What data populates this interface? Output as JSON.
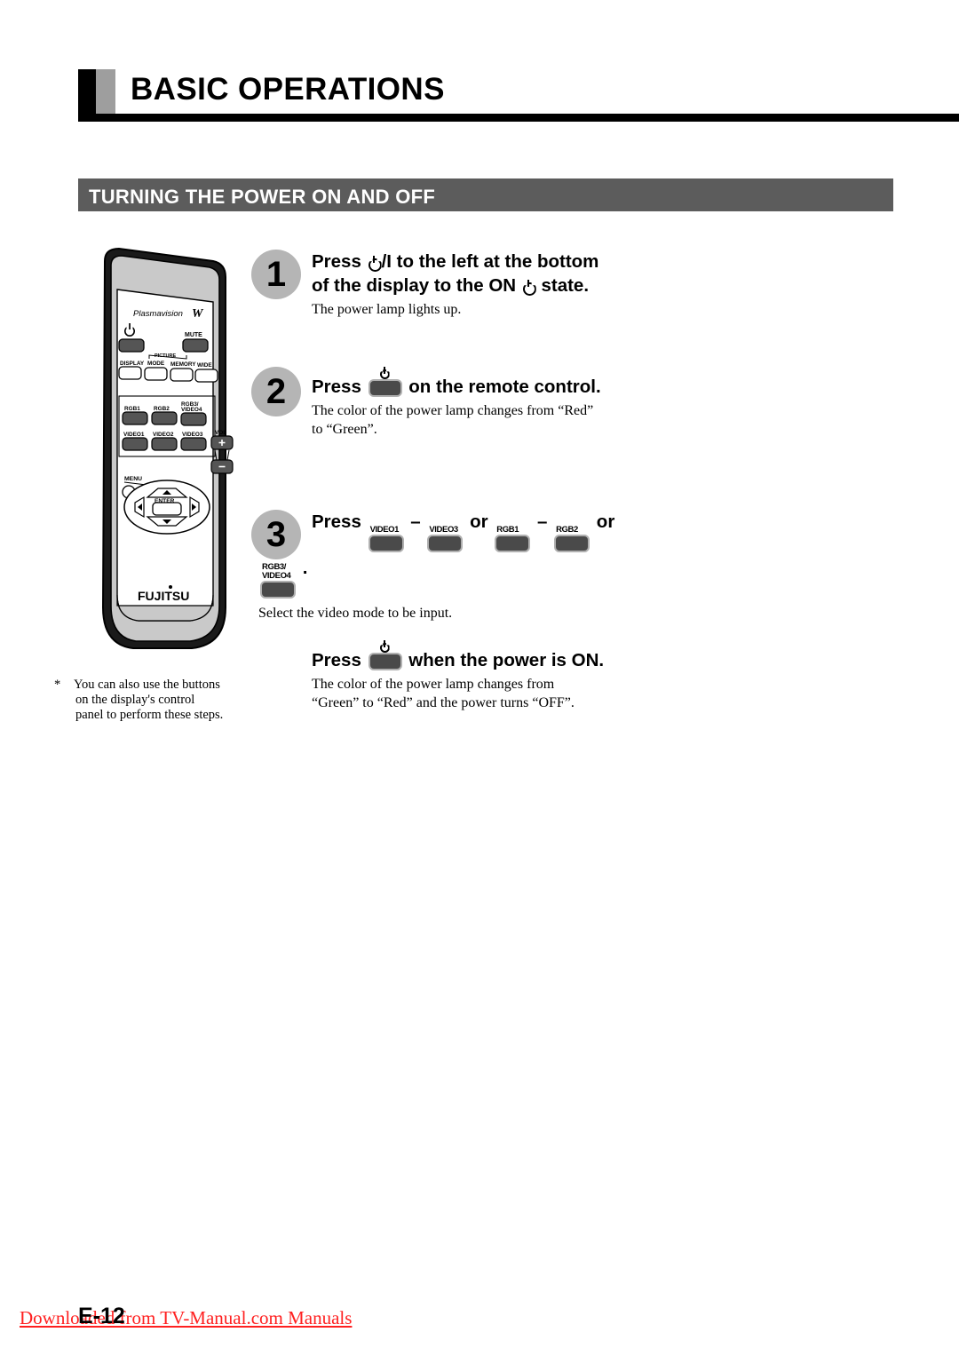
{
  "header": {
    "title": "BASIC OPERATIONS",
    "section_title": "TURNING THE POWER ON AND OFF"
  },
  "figure": {
    "name": "remote-control-illustration",
    "brand_top": "Plasmavision",
    "brand_top_mark": "W",
    "brand_bottom": "FUJITSU",
    "buttons": [
      "MUTE",
      "DISPLAY",
      "MODE",
      "MEMORY",
      "WIDE",
      "PICTURE",
      "RGB1",
      "RGB2",
      "RGB3/\nVIDEO4",
      "VIDEO1",
      "VIDEO2",
      "VIDEO3",
      "VOL",
      "+",
      "-",
      "MENU",
      "ENTER"
    ],
    "labels": {
      "picture": "PICTURE",
      "display": "DISPLAY",
      "mode": "MODE",
      "memory": "MEMORY",
      "wide": "WIDE",
      "mute": "MUTE",
      "rgb1": "RGB1",
      "rgb2": "RGB2",
      "rgb3video4_l1": "RGB3/",
      "rgb3video4_l2": "VIDEO4",
      "video1": "VIDEO1",
      "video2": "VIDEO2",
      "video3": "VIDEO3",
      "vol": "VOL",
      "plus": "+",
      "minus": "-",
      "menu": "MENU",
      "enter": "ENTER"
    }
  },
  "note": {
    "star": "*",
    "line1": "You can also use the buttons",
    "line2": "on the display's control",
    "line3": "panel to perform these steps."
  },
  "steps": [
    {
      "number": "1",
      "head_part1": "Press ",
      "head_slash": "/I to the left at the bottom",
      "head_line2_a": "of the display to the ON ",
      "head_line2_b": " state.",
      "sub": "The power lamp lights up."
    },
    {
      "number": "2",
      "head_press": "Press",
      "head_tail": "on the remote control.",
      "sub_line1": "The color of the power lamp changes from “Red”",
      "sub_line2": "to “Green”."
    },
    {
      "number": "3",
      "head_press": "Press",
      "key1_label": "VIDEO1",
      "sep1": "–",
      "key2_label": "VIDEO3",
      "or1": "or",
      "key3_label": "RGB1",
      "sep2": "–",
      "key4_label": "RGB2",
      "or2": "or",
      "key5_label_l1": "RGB3/",
      "key5_label_l2": "VIDEO4",
      "period": ".",
      "sub": "Select the video mode to be input."
    }
  ],
  "power_off": {
    "head_press": "Press",
    "head_tail": "when the power is ON.",
    "sub_line1": "The color of the power lamp changes from",
    "sub_line2": "“Green” to “Red” and the power turns “OFF”."
  },
  "footer": {
    "page_number": "E-12",
    "watermark": "Downloaded from TV-Manual.com Manuals"
  },
  "colors": {
    "rule_black": "#000000",
    "tab_gray": "#9e9e9e",
    "section_bar_gray": "#5c5c5c",
    "badge_gray": "#b5b5b5",
    "keycap_dark": "#4a4a4a",
    "keycap_border": "#b0b0b0",
    "watermark_red": "#ff2020"
  }
}
